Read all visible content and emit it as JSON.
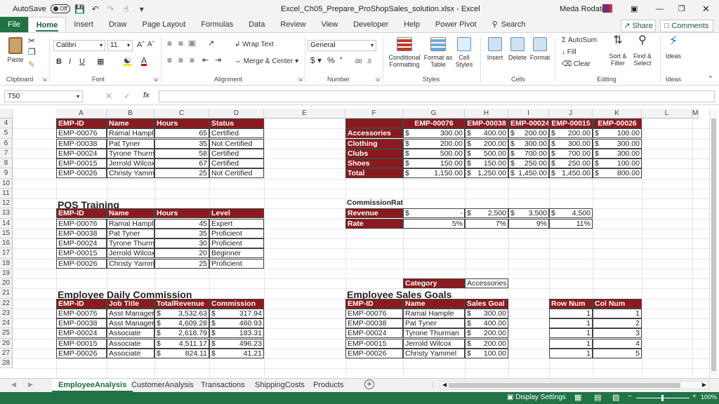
{
  "titlebar": {
    "autosave": "AutoSave",
    "toggle": "Off",
    "filename": "Excel_Ch05_Prepare_ProShopSales_solution.xlsx - Excel",
    "user": "Meda Rodate"
  },
  "menu": {
    "tabs": [
      "File",
      "Home",
      "Insert",
      "Draw",
      "Page Layout",
      "Formulas",
      "Data",
      "Review",
      "View",
      "Developer",
      "Help",
      "Power Pivot"
    ],
    "search": "Search",
    "share": "Share",
    "comments": "Comments"
  },
  "ribbon": {
    "clipboard": {
      "paste": "Paste",
      "label": "Clipboard"
    },
    "font": {
      "name": "Calibri",
      "size": "11",
      "label": "Font",
      "bold": "B",
      "italic": "I",
      "underline": "U"
    },
    "alignment": {
      "wrap": "Wrap Text",
      "merge": "Merge & Center",
      "label": "Alignment"
    },
    "number": {
      "format": "General",
      "label": "Number"
    },
    "styles": {
      "conditional": "Conditional Formatting",
      "format_table": "Format as Table",
      "cell_styles": "Cell Styles",
      "label": "Styles"
    },
    "cells": {
      "insert": "Insert",
      "delete": "Delete",
      "format": "Format",
      "label": "Cells"
    },
    "editing": {
      "autosum": "AutoSum",
      "fill": "Fill",
      "clear": "Clear",
      "sort": "Sort & Filter",
      "find": "Find & Select",
      "label": "Editing"
    },
    "ideas": {
      "ideas": "Ideas",
      "label": "Ideas"
    }
  },
  "formula_bar": {
    "name_box": "T50",
    "fx": "fx",
    "value": ""
  },
  "columns": [
    "A",
    "B",
    "C",
    "D",
    "E",
    "F",
    "G",
    "H",
    "I",
    "J",
    "K",
    "L",
    "M"
  ],
  "rows": [
    "4",
    "5",
    "6",
    "7",
    "8",
    "9",
    "10",
    "11",
    "12",
    "13",
    "14",
    "15",
    "16",
    "17",
    "18",
    "19",
    "20",
    "21",
    "22",
    "23",
    "24",
    "25",
    "26",
    "27",
    "28"
  ],
  "table1": {
    "headers": [
      "EMP-ID",
      "Name",
      "Hours",
      "Status"
    ],
    "rows": [
      [
        "EMP-00076",
        "Ramal Hample",
        "65",
        "Certified"
      ],
      [
        "EMP-00038",
        "Pat Tyner",
        "35",
        "Not Certified"
      ],
      [
        "EMP-00024",
        "Tyrone Thurma",
        "58",
        "Certified"
      ],
      [
        "EMP-00015",
        "Jerrold Wilcox",
        "67",
        "Certified"
      ],
      [
        "EMP-00026",
        "Christy Yamme",
        "25",
        "Not Certified"
      ]
    ]
  },
  "sales": {
    "headers": [
      "EMP-00076",
      "EMP-00038",
      "EMP-00024",
      "EMP-00015",
      "EMP-00026"
    ],
    "rows": [
      {
        "label": "Accessories",
        "values": [
          "300.00",
          "400.00",
          "200.00",
          "200.00",
          "100.00"
        ]
      },
      {
        "label": "Clothing",
        "values": [
          "200.00",
          "200.00",
          "300.00",
          "300.00",
          "300.00"
        ]
      },
      {
        "label": "Clubs",
        "values": [
          "500.00",
          "500.00",
          "700.00",
          "700.00",
          "300.00"
        ]
      },
      {
        "label": "Shoes",
        "values": [
          "150.00",
          "150.00",
          "250.00",
          "250.00",
          "100.00"
        ]
      },
      {
        "label": "Total",
        "values": [
          "1,150.00",
          "1,250.00",
          "1,450.00",
          "1,450.00",
          "800.00"
        ]
      }
    ]
  },
  "pos": {
    "title": "POS Training",
    "headers": [
      "EMP-ID",
      "Name",
      "Hours",
      "Level"
    ],
    "rows": [
      [
        "EMP-00076",
        "Ramal Hample",
        "45",
        "Expert"
      ],
      [
        "EMP-00038",
        "Pat Tyner",
        "35",
        "Proficient"
      ],
      [
        "EMP-00024",
        "Tyrone Thurma",
        "30",
        "Proficient"
      ],
      [
        "EMP-00015",
        "Jerrold Wilcox",
        "20",
        "Beginner"
      ],
      [
        "EMP-00026",
        "Christy Yamme",
        "25",
        "Proficient"
      ]
    ]
  },
  "commission_rates": {
    "title": "CommissionRates",
    "revenue_label": "Revenue",
    "rate_label": "Rate",
    "revenue": [
      "-",
      "2,500",
      "3,500",
      "4,500"
    ],
    "rate": [
      "5%",
      "7%",
      "9%",
      "11%"
    ]
  },
  "category": {
    "label": "Category",
    "value": "Accessories"
  },
  "daily": {
    "title": "Employee Daily Commission",
    "headers": [
      "EMP-ID",
      "Job Title",
      "TotalRevenue",
      "Commission"
    ],
    "rows": [
      [
        "EMP-00076",
        "Asst Manager",
        "3,532.63",
        "317.94"
      ],
      [
        "EMP-00038",
        "Asst Manager",
        "4,609.28",
        "460.93"
      ],
      [
        "EMP-00024",
        "Associate",
        "2,618.79",
        "183.31"
      ],
      [
        "EMP-00015",
        "Associate",
        "4,511.17",
        "496.23"
      ],
      [
        "EMP-00026",
        "Associate",
        "824.11",
        "41.21"
      ]
    ]
  },
  "goals": {
    "title": "Employee Sales Goals",
    "headers": [
      "EMP-ID",
      "Name",
      "Sales Goal"
    ],
    "rows": [
      [
        "EMP-00076",
        "Ramal Hample",
        "300.00"
      ],
      [
        "EMP-00038",
        "Pat Tyner",
        "400.00"
      ],
      [
        "EMP-00024",
        "Tyrone Thurman",
        "200.00"
      ],
      [
        "EMP-00015",
        "Jerrold Wilcox",
        "200.00"
      ],
      [
        "EMP-00026",
        "Christy Yammel",
        "100.00"
      ]
    ]
  },
  "rowcol": {
    "headers": [
      "Row Num",
      "Col Num"
    ],
    "rows": [
      [
        "1",
        "1"
      ],
      [
        "1",
        "2"
      ],
      [
        "1",
        "3"
      ],
      [
        "1",
        "4"
      ],
      [
        "1",
        "5"
      ]
    ]
  },
  "currency": "$",
  "sheets": [
    "EmployeeAnalysis",
    "CustomerAnalysis",
    "Transactions",
    "ShippingCosts",
    "Products"
  ],
  "status": {
    "display": "Display Settings",
    "zoom": "100%"
  },
  "colors": {
    "header_fill": "#8b1a1e",
    "excel_green": "#217346"
  }
}
